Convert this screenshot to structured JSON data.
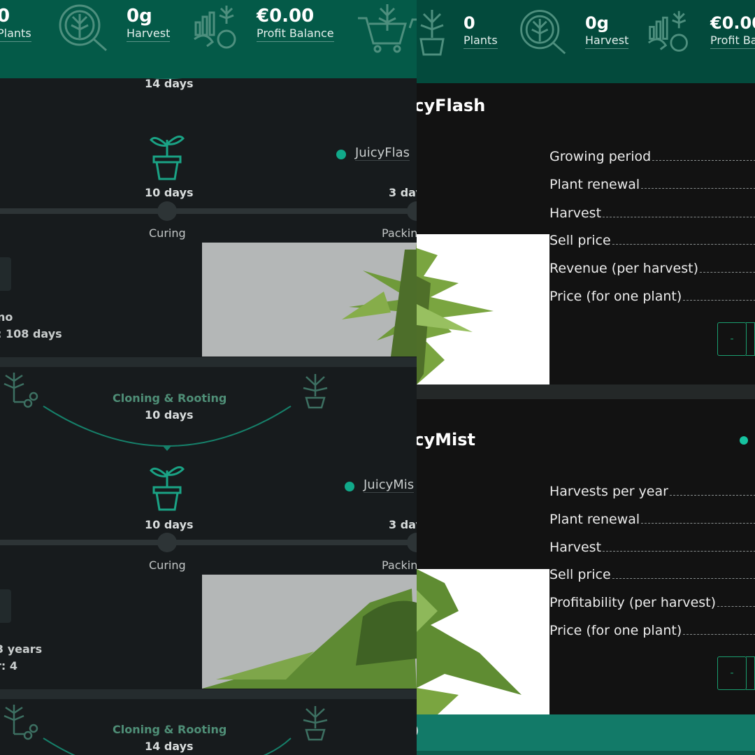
{
  "left": {
    "stats": {
      "plants": {
        "value": "0",
        "label": "Plants"
      },
      "harvest": {
        "value": "0g",
        "label": "Harvest"
      },
      "profit": {
        "value": "€0.00",
        "label": "Profit Balance"
      }
    },
    "sections": [
      {
        "top_days": "14 days",
        "strain": "JuicyFlas",
        "curing_days": "10 days",
        "packing_days": "3 day",
        "curing_label": "Curing",
        "packing_label": "Packin",
        "info_line1": "no",
        "info_line2": ": 108 days"
      },
      {
        "phase_label": "Cloning & Rooting",
        "top_days": "10 days",
        "strain": "JuicyMis",
        "curing_days": "10 days",
        "packing_days": "3 day",
        "curing_label": "Curing",
        "packing_label": "Packin",
        "info_line1": "3 years",
        "info_line2": "r: 4"
      },
      {
        "phase_label": "Cloning & Rooting",
        "top_days": "14 days"
      }
    ]
  },
  "right": {
    "stats": {
      "plants": {
        "value": "0",
        "label": "Plants"
      },
      "harvest": {
        "value": "0g",
        "label": "Harvest"
      },
      "profit": {
        "value": "€0.00",
        "label": "Profit Ba"
      }
    },
    "products": [
      {
        "title": "icyFlash",
        "props": [
          "Growing period",
          "Plant renewal",
          "Harvest",
          "Sell price",
          "Revenue (per harvest)",
          "Price (for one plant)"
        ],
        "minus_label": "-"
      },
      {
        "title": "icyMist",
        "props": [
          "Harvests per year",
          "Plant renewal",
          "Harvest",
          "Sell price",
          "Profitability (per harvest)",
          "Price (for one plant)"
        ],
        "minus_label": "-"
      }
    ],
    "bottom_bar_text": "0"
  },
  "colors": {
    "topbar_left": "#045a48",
    "topbar_right": "#034a3c",
    "accent": "#11a98a",
    "phase_text": "#4f8f77",
    "bottom_bar": "#127a68"
  },
  "icons": [
    "plant-pot-icon",
    "cannabis-magnifier-icon",
    "cannabis-chart-money-icon",
    "cart-icon",
    "sprout-pot-icon",
    "cannabis-leaf-icon",
    "scissors-icon"
  ]
}
